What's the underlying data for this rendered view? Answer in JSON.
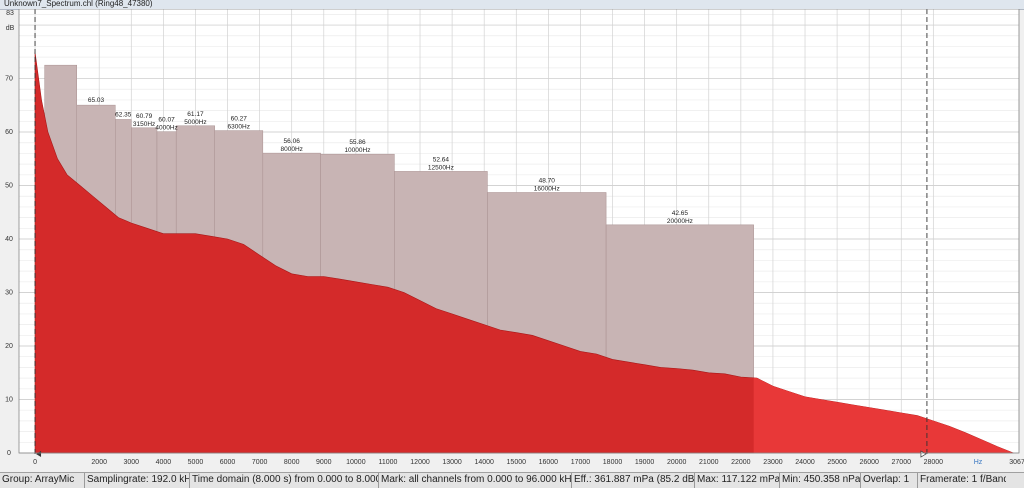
{
  "window": {
    "title": "Unknown7_Spectrum.chl (Ring48_47380)"
  },
  "colors": {
    "spectrum": "#d42a2a",
    "spectrum_highlight": "#e83838",
    "bands": "#c8b4b4",
    "grid": "#d2d2d2",
    "background": "#ffffff",
    "frame": "#f0f0f0"
  },
  "chart_data": {
    "type": "area",
    "xunit": "Hz",
    "yunit": "dB",
    "xlim": [
      -500,
      30670
    ],
    "ylim": [
      0,
      83
    ],
    "ymax_label": "83",
    "x_ticks": [
      0,
      2000,
      3000,
      4000,
      5000,
      6000,
      7000,
      8000,
      9000,
      10000,
      11000,
      12000,
      13000,
      14000,
      15000,
      16000,
      17000,
      18000,
      19000,
      20000,
      21000,
      22000,
      23000,
      24000,
      25000,
      26000,
      27000,
      28000,
      30670
    ],
    "y_ticks": [
      0,
      10,
      20,
      30,
      40,
      50,
      60,
      70
    ],
    "grid": true,
    "cursor_x": [
      0,
      27800
    ],
    "marker_x": 22400,
    "spectrum": [
      [
        0,
        75
      ],
      [
        200,
        66
      ],
      [
        400,
        60
      ],
      [
        700,
        55
      ],
      [
        1000,
        52
      ],
      [
        1400,
        50
      ],
      [
        1800,
        48
      ],
      [
        2200,
        46
      ],
      [
        2600,
        44
      ],
      [
        3000,
        43
      ],
      [
        3500,
        42
      ],
      [
        4000,
        41
      ],
      [
        4500,
        41
      ],
      [
        5000,
        41
      ],
      [
        5500,
        40.5
      ],
      [
        6000,
        40
      ],
      [
        6500,
        39
      ],
      [
        7000,
        37
      ],
      [
        7500,
        35
      ],
      [
        8000,
        33.5
      ],
      [
        8500,
        33
      ],
      [
        9000,
        33
      ],
      [
        9500,
        32.5
      ],
      [
        10000,
        32
      ],
      [
        10500,
        31.5
      ],
      [
        11000,
        31
      ],
      [
        11500,
        30
      ],
      [
        12000,
        28.5
      ],
      [
        12500,
        27
      ],
      [
        13000,
        26
      ],
      [
        13500,
        25
      ],
      [
        14000,
        24
      ],
      [
        14500,
        23
      ],
      [
        15000,
        22.5
      ],
      [
        15500,
        22
      ],
      [
        16000,
        21
      ],
      [
        16500,
        20
      ],
      [
        17000,
        19
      ],
      [
        17500,
        18.5
      ],
      [
        18000,
        17.5
      ],
      [
        18500,
        17
      ],
      [
        19000,
        16.5
      ],
      [
        19500,
        16
      ],
      [
        20000,
        15.8
      ],
      [
        20500,
        15.5
      ],
      [
        21000,
        15
      ],
      [
        21500,
        14.8
      ],
      [
        22000,
        14.2
      ],
      [
        22500,
        14
      ],
      [
        23000,
        12.5
      ],
      [
        23500,
        11.5
      ],
      [
        24000,
        10.5
      ],
      [
        24500,
        10
      ],
      [
        25000,
        9.5
      ],
      [
        25500,
        9
      ],
      [
        26000,
        8.5
      ],
      [
        26500,
        8
      ],
      [
        27000,
        7.5
      ],
      [
        27500,
        7
      ],
      [
        28000,
        6
      ],
      [
        28500,
        5
      ],
      [
        29000,
        3.8
      ],
      [
        29500,
        2.5
      ],
      [
        30000,
        1.2
      ],
      [
        30500,
        0
      ]
    ],
    "bands": [
      {
        "x0": 300,
        "x1": 1300,
        "value": 72.5,
        "label_value": "",
        "label_freq": ""
      },
      {
        "x0": 1300,
        "x1": 2500,
        "value": 65.03,
        "label_value": "65.03",
        "label_freq": ""
      },
      {
        "x0": 2500,
        "x1": 3000,
        "value": 62.35,
        "label_value": "62.35",
        "label_freq": ""
      },
      {
        "x0": 3000,
        "x1": 3800,
        "value": 60.79,
        "label_value": "60.79",
        "label_freq": "3150Hz"
      },
      {
        "x0": 3800,
        "x1": 4400,
        "value": 60.07,
        "label_value": "60.07",
        "label_freq": "4000Hz"
      },
      {
        "x0": 4400,
        "x1": 5600,
        "value": 61.17,
        "label_value": "61.17",
        "label_freq": "5000Hz"
      },
      {
        "x0": 5600,
        "x1": 7100,
        "value": 60.27,
        "label_value": "60.27",
        "label_freq": "6300Hz"
      },
      {
        "x0": 7100,
        "x1": 8900,
        "value": 56.06,
        "label_value": "56.06",
        "label_freq": "8000Hz"
      },
      {
        "x0": 8900,
        "x1": 11200,
        "value": 55.86,
        "label_value": "55.86",
        "label_freq": "10000Hz"
      },
      {
        "x0": 11200,
        "x1": 14100,
        "value": 52.64,
        "label_value": "52.64",
        "label_freq": "12500Hz"
      },
      {
        "x0": 14100,
        "x1": 17800,
        "value": 48.7,
        "label_value": "48.70",
        "label_freq": "16000Hz"
      },
      {
        "x0": 17800,
        "x1": 22400,
        "value": 42.65,
        "label_value": "42.65",
        "label_freq": "20000Hz"
      }
    ]
  },
  "status": [
    "Group: ArrayMic",
    "Samplingrate: 192.0 kHz",
    "Time domain (8.000 s) from 0.000 to 8.000 s",
    "Mark: all channels from 0.000 to 96.000 kHz",
    "Eff.: 361.887 mPa (85.2 dB)",
    "Max: 117.122 mPa",
    "Min: 450.358 nPa",
    "Overlap: 1",
    "Framerate: 1 f/Band"
  ]
}
